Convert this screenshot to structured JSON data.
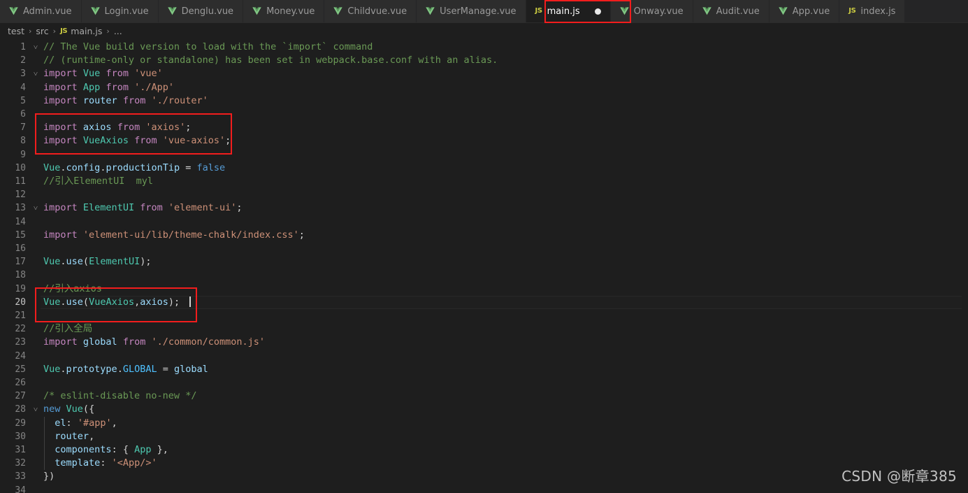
{
  "window": {
    "background": "#1e1e1e",
    "annotation_color": "#f21d1d"
  },
  "tabbar": {
    "tabs": [
      {
        "label": "Admin.vue",
        "icon": "vue-icon",
        "active": false,
        "dirty": false
      },
      {
        "label": "Login.vue",
        "icon": "vue-icon",
        "active": false,
        "dirty": false
      },
      {
        "label": "Denglu.vue",
        "icon": "vue-icon",
        "active": false,
        "dirty": false
      },
      {
        "label": "Money.vue",
        "icon": "vue-icon",
        "active": false,
        "dirty": false
      },
      {
        "label": "Childvue.vue",
        "icon": "vue-icon",
        "active": false,
        "dirty": false
      },
      {
        "label": "UserManage.vue",
        "icon": "vue-icon",
        "active": false,
        "dirty": false
      },
      {
        "label": "main.js",
        "icon": "js-icon",
        "active": true,
        "dirty": true
      },
      {
        "label": "Onway.vue",
        "icon": "vue-icon",
        "active": false,
        "dirty": false
      },
      {
        "label": "Audit.vue",
        "icon": "vue-icon",
        "active": false,
        "dirty": false
      },
      {
        "label": "App.vue",
        "icon": "vue-icon",
        "active": false,
        "dirty": false
      },
      {
        "label": "index.js",
        "icon": "js-icon",
        "active": false,
        "dirty": false
      }
    ],
    "js_icon_text": "JS"
  },
  "breadcrumb": {
    "items": [
      "test",
      "src",
      "main.js",
      "..."
    ],
    "separator": "›",
    "file_icon_text": "JS"
  },
  "editor": {
    "filename": "main.js",
    "language": "javascript",
    "cursor_line": 20,
    "first_line": 1,
    "last_line": 34,
    "lines": [
      {
        "n": 1,
        "fold": "˅",
        "text": "// The Vue build version to load with the `import` command"
      },
      {
        "n": 2,
        "fold": "",
        "text": "// (runtime-only or standalone) has been set in webpack.base.conf with an alias."
      },
      {
        "n": 3,
        "fold": "˅",
        "text": "import Vue from 'vue'"
      },
      {
        "n": 4,
        "fold": "",
        "text": "import App from './App'"
      },
      {
        "n": 5,
        "fold": "",
        "text": "import router from './router'"
      },
      {
        "n": 6,
        "fold": "",
        "text": ""
      },
      {
        "n": 7,
        "fold": "",
        "text": "import axios from 'axios';"
      },
      {
        "n": 8,
        "fold": "",
        "text": "import VueAxios from 'vue-axios';"
      },
      {
        "n": 9,
        "fold": "",
        "text": ""
      },
      {
        "n": 10,
        "fold": "",
        "text": "Vue.config.productionTip = false"
      },
      {
        "n": 11,
        "fold": "",
        "text": "//引入ElementUI  myl"
      },
      {
        "n": 12,
        "fold": "",
        "text": ""
      },
      {
        "n": 13,
        "fold": "˅",
        "text": "import ElementUI from 'element-ui';"
      },
      {
        "n": 14,
        "fold": "",
        "text": ""
      },
      {
        "n": 15,
        "fold": "",
        "text": "import 'element-ui/lib/theme-chalk/index.css';"
      },
      {
        "n": 16,
        "fold": "",
        "text": ""
      },
      {
        "n": 17,
        "fold": "",
        "text": "Vue.use(ElementUI);"
      },
      {
        "n": 18,
        "fold": "",
        "text": ""
      },
      {
        "n": 19,
        "fold": "",
        "text": "//引入axios"
      },
      {
        "n": 20,
        "fold": "",
        "text": "Vue.use(VueAxios,axios);"
      },
      {
        "n": 21,
        "fold": "",
        "text": ""
      },
      {
        "n": 22,
        "fold": "",
        "text": "//引入全局"
      },
      {
        "n": 23,
        "fold": "",
        "text": "import global from './common/common.js'"
      },
      {
        "n": 24,
        "fold": "",
        "text": ""
      },
      {
        "n": 25,
        "fold": "",
        "text": "Vue.prototype.GLOBAL = global"
      },
      {
        "n": 26,
        "fold": "",
        "text": ""
      },
      {
        "n": 27,
        "fold": "",
        "text": "/* eslint-disable no-new */"
      },
      {
        "n": 28,
        "fold": "˅",
        "text": "new Vue({"
      },
      {
        "n": 29,
        "fold": "",
        "text": "  el: '#app',"
      },
      {
        "n": 30,
        "fold": "",
        "text": "  router,"
      },
      {
        "n": 31,
        "fold": "",
        "text": "  components: { App },"
      },
      {
        "n": 32,
        "fold": "",
        "text": "  template: '<App/>'"
      },
      {
        "n": 33,
        "fold": "",
        "text": "})"
      },
      {
        "n": 34,
        "fold": "",
        "text": ""
      }
    ],
    "annotations": [
      {
        "name": "axios-imports-highlight",
        "lines": "7-8"
      },
      {
        "name": "axios-use-highlight",
        "lines": "19-20"
      }
    ]
  },
  "watermark": {
    "text": "CSDN @断章385"
  }
}
